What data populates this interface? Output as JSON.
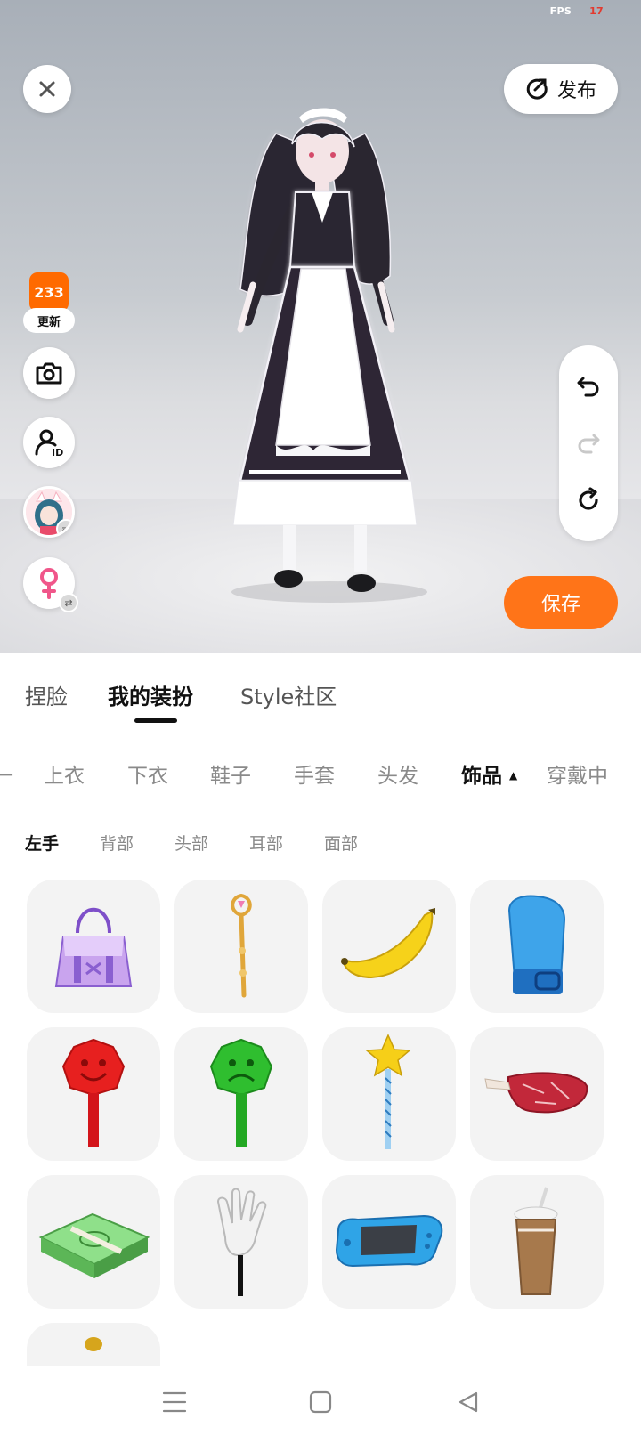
{
  "status": {
    "fps_label": "FPS",
    "fps_value": "17"
  },
  "top_bar": {
    "publish_label": "发布"
  },
  "side_buttons": {
    "update_logo": "233",
    "update_label": "更新"
  },
  "save_label": "保存",
  "main_tabs": [
    {
      "label": "捏脸"
    },
    {
      "label": "我的装扮"
    },
    {
      "label": "Style社区"
    }
  ],
  "categories": [
    {
      "label": "上衣"
    },
    {
      "label": "下衣"
    },
    {
      "label": "鞋子"
    },
    {
      "label": "手套"
    },
    {
      "label": "头发"
    },
    {
      "label": "饰品"
    },
    {
      "label": "穿戴中"
    }
  ],
  "subcategories": [
    {
      "label": "左手"
    },
    {
      "label": "背部"
    },
    {
      "label": "头部"
    },
    {
      "label": "耳部"
    },
    {
      "label": "面部"
    }
  ],
  "items": [
    {
      "icon": "purple-handbag-icon"
    },
    {
      "icon": "magic-staff-icon"
    },
    {
      "icon": "banana-icon"
    },
    {
      "icon": "boxing-glove-icon"
    },
    {
      "icon": "red-smiley-sign-icon"
    },
    {
      "icon": "green-sad-sign-icon"
    },
    {
      "icon": "star-wand-icon"
    },
    {
      "icon": "meat-icon"
    },
    {
      "icon": "money-stack-icon"
    },
    {
      "icon": "glove-hand-stick-icon"
    },
    {
      "icon": "game-console-icon"
    },
    {
      "icon": "coffee-cup-icon"
    },
    {
      "icon": "partial-item-icon"
    }
  ],
  "colors": {
    "accent": "#ff7418",
    "active_text": "#111111",
    "inactive_text": "#8a8a8a",
    "tile_bg": "#f3f3f3"
  }
}
